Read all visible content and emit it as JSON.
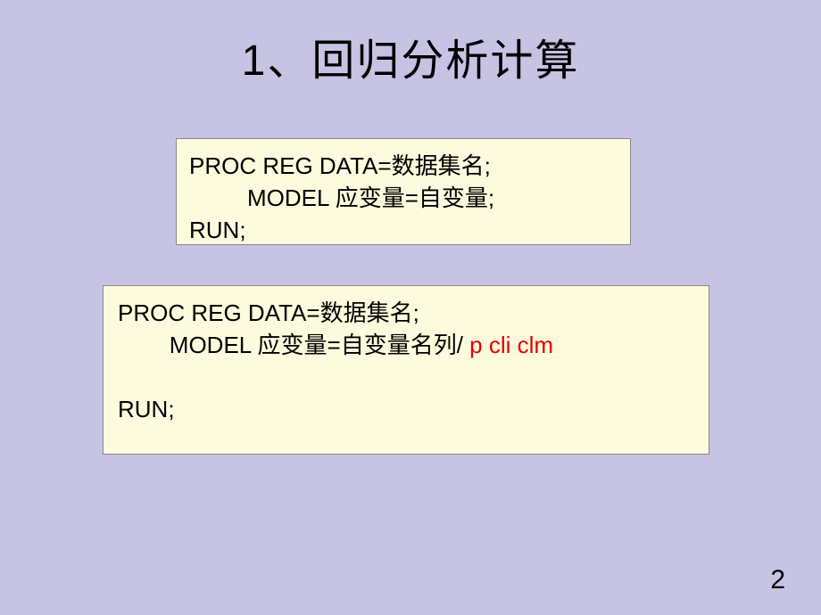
{
  "title": "1、回归分析计算",
  "box1": {
    "line1": "PROC REG DATA=数据集名;",
    "line2": "         MODEL 应变量=自变量;",
    "line3": "RUN;"
  },
  "box2": {
    "line1": "PROC REG DATA=数据集名;",
    "line2_part1": "        MODEL 应变量=自变量名列/ ",
    "line2_part2": "p cli clm",
    "line3": "RUN;"
  },
  "page_number": "2"
}
